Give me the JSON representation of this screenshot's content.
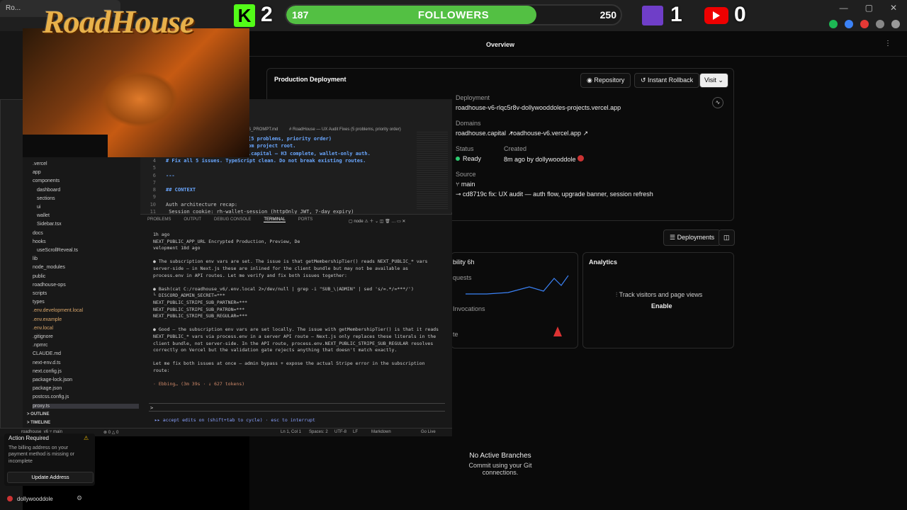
{
  "browser": {
    "tab_title": "Ro...",
    "window_controls": [
      "—",
      "▢",
      "✕"
    ]
  },
  "overlay": {
    "kick_count": "2",
    "followers_current": "187",
    "followers_label": "FOLLOWERS",
    "followers_goal": "250",
    "followers_progress": 0.748,
    "twitch_count": "1",
    "youtube_count": "0",
    "logo_text": "RoadHouse"
  },
  "vercel": {
    "page_title": "Overview",
    "deployment_card_title": "Production Deployment",
    "repository_label": "Repository",
    "instant_rollback_label": "Instant Rollback",
    "visit_label": "Visit",
    "deployment_label": "Deployment",
    "deployment_url": "roadhouse-v6-rlqc5r8v-dollywooddoles-projects.vercel.app",
    "domains_label": "Domains",
    "domain_1": "roadhouse.capital",
    "domain_2": "roadhouse-v6.vercel.app",
    "status_label": "Status",
    "created_label": "Created",
    "status_value": "Ready",
    "created_value": "8m ago by dollywooddole",
    "source_label": "Source",
    "branch": "main",
    "commit": "cd8719c  fix: UX audit — auth flow, upgrade banner, session refresh",
    "deployments_button": "Deployments",
    "observability_label": "bility 6h",
    "requests_label": "quests",
    "invocations_label": "Invocations",
    "rate_label": "te",
    "analytics_title": "Analytics",
    "analytics_desc": "Track visitors and page views",
    "analytics_enable": "Enable",
    "no_branches_title": "No Active Branches",
    "no_branches_desc": "Commit using your Git connections."
  },
  "action": {
    "title": "Action Required",
    "desc": "The billing address on your payment method is missing or incomplete",
    "button": "Update Address",
    "user": "dollywooddole"
  },
  "explorer": {
    "items": [
      ".vercel",
      "app",
      "components",
      "dashboard",
      "sections",
      "ui",
      "wallet",
      "Sidebar.tsx",
      "docs",
      "hooks",
      "useScrollReveal.ts",
      "lib",
      "node_modules",
      "public",
      "roadhouse-ops",
      "scripts",
      "types",
      ".env.development.local",
      ".env.example",
      ".env.local",
      ".gitignore",
      ".npmrc",
      "CLAUDE.md",
      "next-env.d.ts",
      "next.config.js",
      "package-lock.json",
      "package.json",
      "postcss.config.js",
      "proxy.ts"
    ],
    "outline": "OUTLINE",
    "timeline": "TIMELINE"
  },
  "editor": {
    "tab_label": "S_PROMPT.md",
    "breadcrumb": "# RoadHouse — UX Audit Fixes (5 problems, priority order)",
    "lines": [
      {
        "n": "",
        "t": "(5 problems, priority order)"
      },
      {
        "n": "",
        "t": "om project root."
      },
      {
        "n": "",
        "t": ".capital — H3 complete, wallet-only auth."
      },
      {
        "n": "4",
        "t": "# Fix all 5 issues. TypeScript clean. Do not break existing routes."
      },
      {
        "n": "5",
        "t": ""
      },
      {
        "n": "6",
        "t": "---"
      },
      {
        "n": "7",
        "t": ""
      },
      {
        "n": "8",
        "t": "## CONTEXT"
      },
      {
        "n": "9",
        "t": ""
      },
      {
        "n": "10",
        "t": "Auth architecture recap:"
      },
      {
        "n": "11",
        "t": "  Session cookie: rh-wallet-session (httpOnly JWT, 7-day expiry)"
      }
    ]
  },
  "terminal": {
    "tabs": [
      "PROBLEMS",
      "OUTPUT",
      "DEBUG CONSOLE",
      "TERMINAL",
      "PORTS"
    ],
    "shell": "node",
    "lines": [
      "        1h ago",
      " NEXT_PUBLIC_APP_URL                        Encrypted                    Production, Preview, De",
      "velopment    18d ago",
      "",
      "● The subscription env vars are set. The issue is that getMembershipTier() reads NEXT_PUBLIC_* vars",
      "  server-side — in Next.js these are inlined for the client bundle but may not be available as",
      "  process.env in API routes. Let me verify and fix both issues together:",
      "",
      "● Bash(cat C:/roadhouse_v6/.env.local 2>/dev/null | grep -i \"SUB_\\|ADMIN\" | sed 's/=.*/=***/')",
      "  └ DISCORD_ADMIN_SECRET=***",
      "    NEXT_PUBLIC_STRIPE_SUB_PARTNER=***",
      "    NEXT_PUBLIC_STRIPE_SUB_PATRON=***",
      "    NEXT_PUBLIC_STRIPE_SUB_REGULAR=***",
      "",
      "● Good — the subscription env vars are set locally. The issue with getMembershipTier() is that it reads",
      "  NEXT_PUBLIC_* vars via process.env in a server API route — Next.js only replaces these literals in the",
      "  client bundle, not server-side. In the API route, process.env.NEXT_PUBLIC_STRIPE_SUB_REGULAR resolves",
      "  correctly on Vercel but the validation gate rejects anything that doesn't match exactly.",
      "",
      "  Let me fix both issues at once — admin bypass + expose the actual Stripe error in the subscription",
      "  route:",
      "",
      "· Ebbing… (3m 39s · ↓ 627 tokens)"
    ],
    "prompt": ">",
    "footer": "▸▸ accept edits on (shift+tab to cycle) · esc to interrupt"
  },
  "status": {
    "branch": "roadhouse_v6  ⑂ main",
    "errors": "⊗ 0  △ 0",
    "position": "Ln 1, Col 1",
    "spaces": "Spaces: 2",
    "encoding": "UTF-8",
    "eol": "LF",
    "lang": "Markdown",
    "golive": "Go Live"
  },
  "colors": {
    "kick_green": "#53fc18",
    "progress_green": "#53c043",
    "twitch_purple": "#6f3ec8",
    "youtube_red": "#e00000",
    "ready_green": "#2ecc71"
  }
}
